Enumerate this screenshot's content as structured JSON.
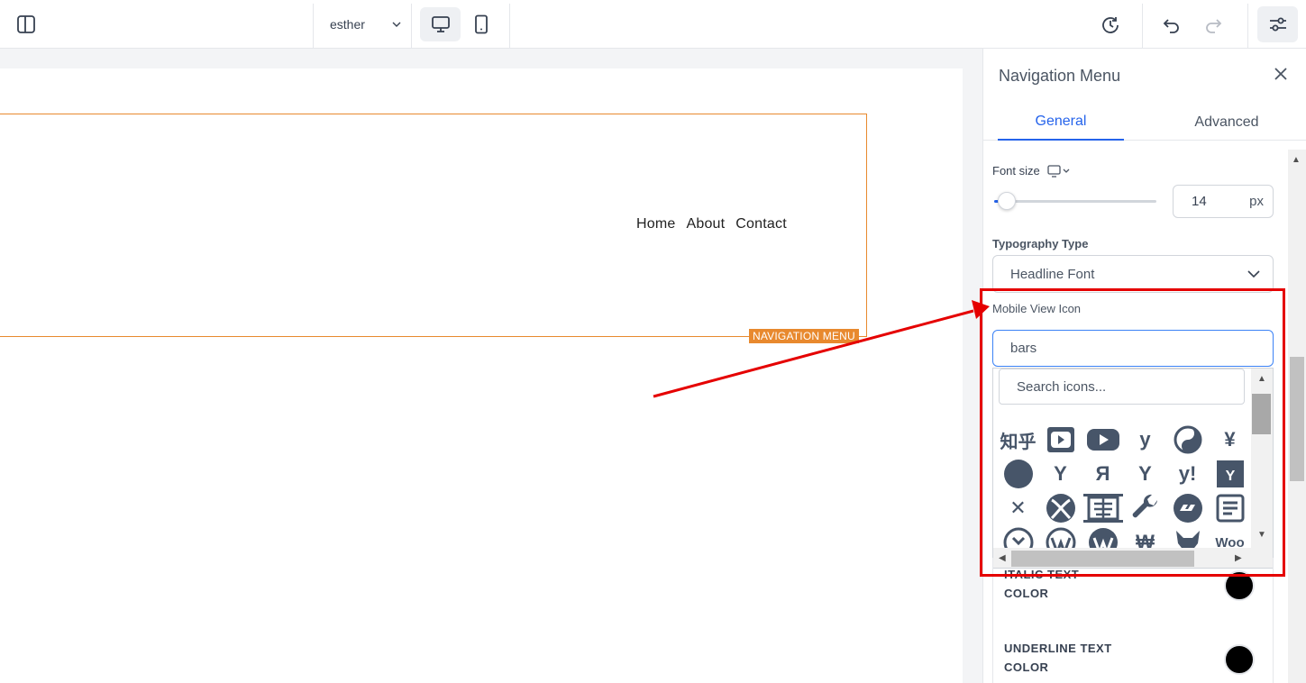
{
  "topbar": {
    "user_select": "esther",
    "accent": "#2563eb"
  },
  "canvas": {
    "nav_links": [
      "Home",
      "About",
      "Contact"
    ],
    "element_tag": "NAVIGATION MENU",
    "tag_color": "#e8892e"
  },
  "panel": {
    "title": "Navigation Menu",
    "tabs": [
      "General",
      "Advanced"
    ],
    "active_tab": "General",
    "font_size": {
      "label": "Font size",
      "value": "14",
      "unit": "px",
      "slider_fraction": 0.02
    },
    "typography": {
      "label": "Typography Type",
      "value": "Headline Font"
    },
    "mobile_icon": {
      "label": "Mobile View Icon",
      "value": "bars",
      "search_placeholder": "Search icons...",
      "icons": [
        "zhihu-icon",
        "youtube-square-icon",
        "youtube-icon",
        "yoast-icon",
        "yin-yang-icon",
        "yen-sign-icon",
        "circle-icon",
        "y-combinator-icon",
        "yandex-icon",
        "yandex-international-icon",
        "yahoo-icon",
        "y-combinator-square-icon",
        "xing-icon",
        "xbox-icon",
        "x-ray-icon",
        "wrench-icon",
        "wpressr-icon",
        "wpforms-icon",
        "wpexplorer-icon",
        "wordpress-icon",
        "wordpress-simple-icon",
        "won-sign-icon",
        "wolf-pack-battalion-icon",
        "woocommerce-icon"
      ],
      "icon_glyphs": [
        "知乎",
        "",
        "",
        "y",
        "",
        "¥",
        "",
        "Y",
        "Я",
        "Y",
        "y!",
        "Y",
        "✕",
        "",
        "",
        "",
        "",
        "",
        "",
        "",
        "",
        "₩",
        "",
        "Woo"
      ]
    },
    "colors": [
      {
        "label_line1": "ITALIC TEXT",
        "label_line2": "COLOR",
        "value": "#000000"
      },
      {
        "label_line1": "UNDERLINE TEXT",
        "label_line2": "COLOR",
        "value": "#000000"
      }
    ]
  },
  "annotation": {
    "highlight_color": "#e50000"
  }
}
